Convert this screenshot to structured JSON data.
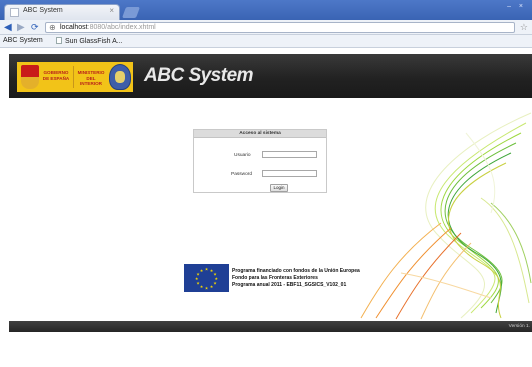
{
  "browser": {
    "tab_title": "ABC System",
    "tab_close": "×",
    "window_controls": "– ×",
    "url_host": "localhost",
    "url_path": ":8080/abc/index.xhtml",
    "bookmarks": [
      "ABC System",
      "Sun GlassFish A..."
    ]
  },
  "header": {
    "logo_gobierno": "GOBIERNO DE ESPAÑA",
    "logo_ministerio": "MINISTERIO DEL INTERIOR",
    "app_title": "ABC System"
  },
  "login": {
    "heading": "Acceso al sistema",
    "user_label": "Usuario",
    "user_value": "",
    "password_label": "Password",
    "password_value": "",
    "button_label": "Login"
  },
  "funding": {
    "line1": "Programa financiado con fondos de la Unión Europea",
    "line2": "Fondo para las Fronteras Exteriores",
    "line3": "Programa anual 2011 - EBF11_SGSICS_V102_01"
  },
  "footer": {
    "version": "Versión 1."
  },
  "colors": {
    "chrome_blue": "#3a64b4",
    "header_dark": "#222222",
    "eu_blue": "#1f3f95",
    "eu_star": "#f5d800",
    "gob_yellow": "#f2c318"
  },
  "icons": [
    "back-arrow-icon",
    "forward-arrow-icon",
    "reload-icon",
    "globe-icon",
    "bookmark-star-icon",
    "page-icon",
    "escudo-icon",
    "police-emblem-icon",
    "eu-flag-icon"
  ]
}
